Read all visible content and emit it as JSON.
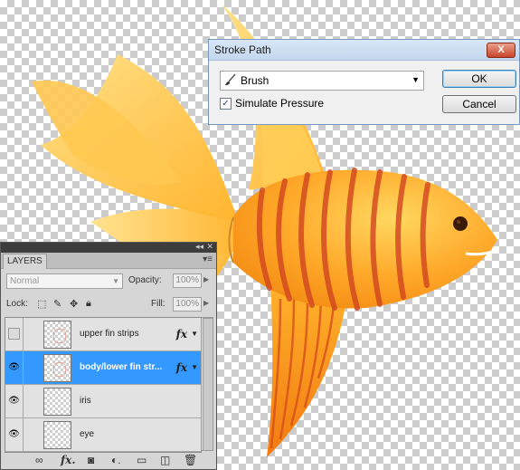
{
  "dialog": {
    "title": "Stroke Path",
    "close_glyph": "X",
    "tool": "Brush",
    "tool_icon": "brush-icon",
    "simulate_pressure": {
      "label": "Simulate Pressure",
      "checked": true
    },
    "ok_label": "OK",
    "cancel_label": "Cancel"
  },
  "layers_panel": {
    "tab": "LAYERS",
    "blend_mode": "Normal",
    "opacity_label": "Opacity:",
    "opacity": "100%",
    "lock_label": "Lock:",
    "fill_label": "Fill:",
    "fill": "100%",
    "layers": [
      {
        "name": "upper fin strips",
        "visible": false,
        "selected": false,
        "fx": "fx"
      },
      {
        "name": "body/lower fin str...",
        "visible": true,
        "selected": true,
        "fx": "fx"
      },
      {
        "name": "iris",
        "visible": true,
        "selected": false
      },
      {
        "name": "eye",
        "visible": true,
        "selected": false
      }
    ],
    "bottom_icons": [
      "link-icon",
      "fx-icon",
      "mask-icon",
      "adjustment-icon",
      "folder-icon",
      "new-layer-icon",
      "trash-icon"
    ]
  },
  "colors": {
    "selection": "#3399ff",
    "fish_orange": "#f7a21b",
    "stripe": "#d2451f"
  }
}
